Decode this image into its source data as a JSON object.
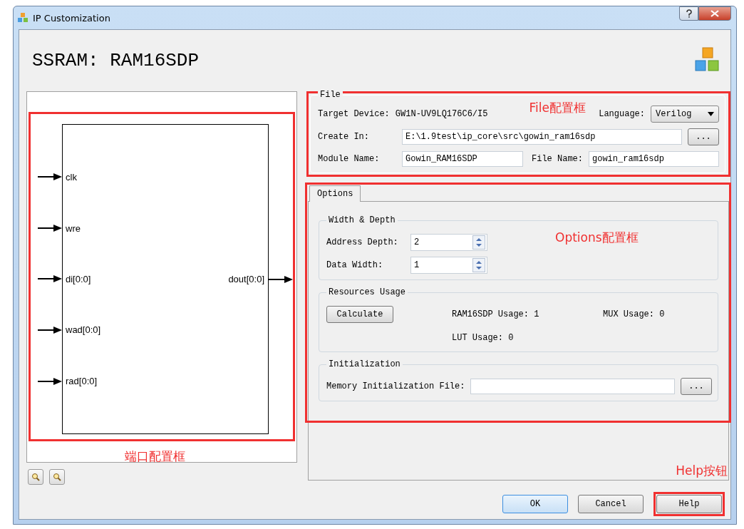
{
  "window": {
    "title": "IP Customization"
  },
  "heading": "SSRAM: RAM16SDP",
  "diagram": {
    "inputs": [
      "clk",
      "wre",
      "di[0:0]",
      "wad[0:0]",
      "rad[0:0]"
    ],
    "outputs": [
      "dout[0:0]"
    ],
    "annotation": "端口配置框"
  },
  "file": {
    "legend": "File",
    "annotation": "File配置框",
    "target_device_label": "Target Device:",
    "target_device": "GW1N-UV9LQ176C6/I5",
    "language_label": "Language:",
    "language": "Verilog",
    "create_in_label": "Create In:",
    "create_in": "E:\\1.9test\\ip_core\\src\\gowin_ram16sdp",
    "browse": "...",
    "module_name_label": "Module Name:",
    "module_name": "Gowin_RAM16SDP",
    "file_name_label": "File Name:",
    "file_name": "gowin_ram16sdp"
  },
  "tabs": [
    {
      "label": "Options",
      "selected": true
    }
  ],
  "options": {
    "annotation": "Options配置框",
    "width_depth": {
      "legend": "Width & Depth",
      "fields": [
        {
          "label": "Address Depth:",
          "value": "2"
        },
        {
          "label": "Data Width:",
          "value": "1"
        }
      ]
    },
    "resources": {
      "legend": "Resources Usage",
      "button": "Calculate",
      "ram_usage": "RAM16SDP Usage: 1",
      "mux_usage": "MUX Usage: 0",
      "lut_usage": "LUT Usage: 0"
    },
    "initialization": {
      "legend": "Initialization",
      "label": "Memory Initialization File:",
      "browse": "..."
    }
  },
  "help_annotation": "Help按钮",
  "buttons": [
    "OK",
    "Cancel",
    "Help"
  ]
}
